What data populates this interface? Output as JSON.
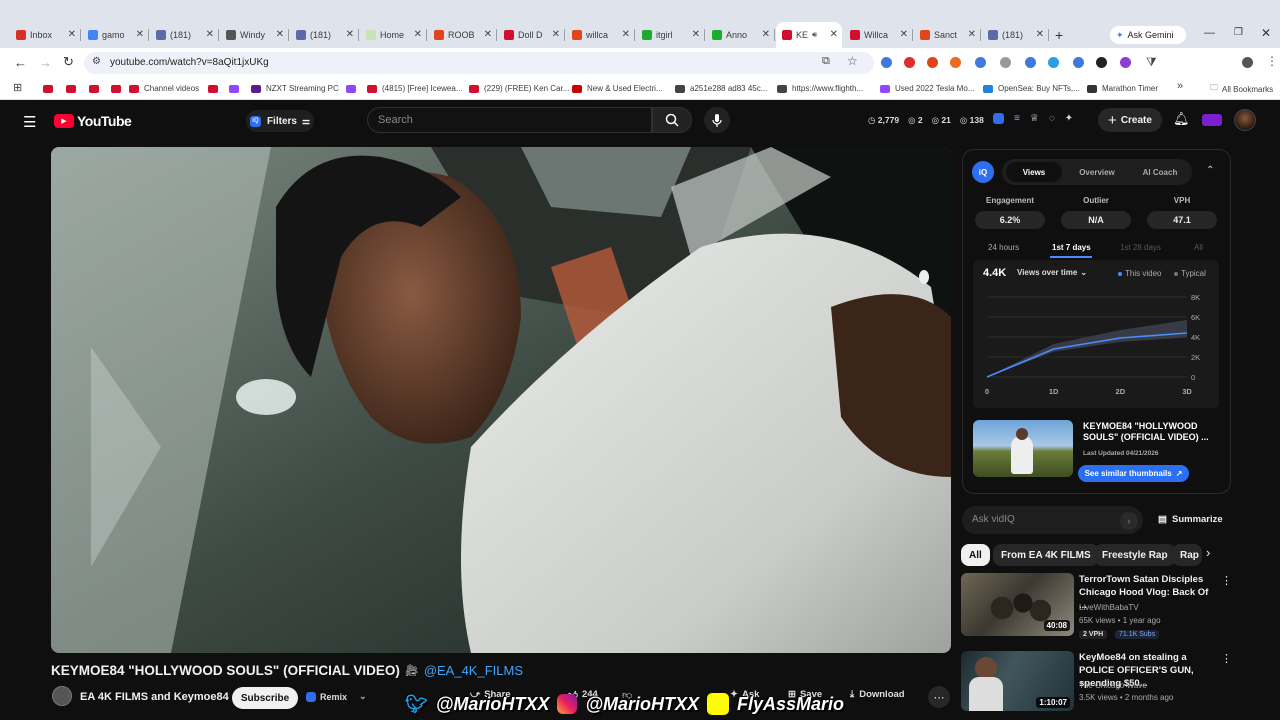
{
  "browser": {
    "tabs": [
      {
        "label": "Inbox",
        "color": "#d93025"
      },
      {
        "label": "gamo",
        "color": "#4285f4"
      },
      {
        "label": "(181)",
        "color": "#5b6ba8"
      },
      {
        "label": "Windy",
        "color": "#555"
      },
      {
        "label": "(181)",
        "color": "#5b6ba8"
      },
      {
        "label": "Home",
        "color": "#c9e2b3"
      },
      {
        "label": "ROOB",
        "color": "#e0451b"
      },
      {
        "label": "Doll D",
        "color": "#d20f2e"
      },
      {
        "label": "willca",
        "color": "#e0451b"
      },
      {
        "label": "itgirl",
        "color": "#1dab2f"
      },
      {
        "label": "Anno",
        "color": "#1dab2f"
      },
      {
        "label": "KE",
        "color": "#d20f2e"
      },
      {
        "label": "Willca",
        "color": "#d20f2e"
      },
      {
        "label": "Sanct",
        "color": "#e0451b"
      },
      {
        "label": "(181)",
        "color": "#5b6ba8"
      }
    ],
    "ask_gemini": "Ask Gemini",
    "url": "youtube.com/watch?v=8aQit1jxUKg",
    "bookmarks": [
      {
        "label": "",
        "color": "#d20f2e"
      },
      {
        "label": "",
        "color": "#d20f2e"
      },
      {
        "label": "",
        "color": "#d20f2e"
      },
      {
        "label": "",
        "color": "#d20f2e"
      },
      {
        "label": "Channel videos",
        "color": "#d20f2e"
      },
      {
        "label": "",
        "color": "#d20f2e"
      },
      {
        "label": "",
        "color": "#9146ff"
      },
      {
        "label": "NZXT Streaming PC",
        "color": "#5b1d8c"
      },
      {
        "label": "",
        "color": "#9146ff"
      },
      {
        "label": "(4815) [Free] Icewea...",
        "color": "#d20f2e"
      },
      {
        "label": "(229) (FREE) Ken Car...",
        "color": "#d20f2e"
      },
      {
        "label": "New & Used Electri...",
        "color": "#cc0000"
      },
      {
        "label": "a251e288 ad83 45c...",
        "color": "#444"
      },
      {
        "label": "https://www.flighth...",
        "color": "#444"
      },
      {
        "label": "Used 2022 Tesla Mo...",
        "color": "#9146ff"
      },
      {
        "label": "OpenSea: Buy NFTs,...",
        "color": "#2081e2"
      },
      {
        "label": "Marathon Timer",
        "color": "#333"
      }
    ],
    "all_bookmarks": "All Bookmarks"
  },
  "youtube": {
    "logo": "YouTube",
    "filters": "Filters",
    "search_placeholder": "Search",
    "stats": {
      "a": "2,779",
      "b": "2",
      "c": "21",
      "d": "138"
    },
    "create": "Create",
    "video": {
      "title": "KEYMOE84 \"HOLLYWOOD SOULS\" (OFFICIAL VIDEO)",
      "handle": "@EA_4K_FILMS",
      "channel": "EA 4K FILMS and Keymoe84",
      "subscribe": "Subscribe",
      "remix": "Remix",
      "share": "Share",
      "likes": "244",
      "ask": "Ask",
      "save": "Save",
      "download": "Download"
    },
    "overlay": {
      "twitter": "@MarioHTXX",
      "instagram": "@MarioHTXX",
      "snapchat": "FlyAssMario"
    }
  },
  "vidiq": {
    "tabs": [
      "Views",
      "Overview",
      "AI Coach"
    ],
    "metrics": [
      {
        "label": "Engagement",
        "value": "6.2%"
      },
      {
        "label": "Outlier",
        "value": "N/A"
      },
      {
        "label": "VPH",
        "value": "47.1"
      }
    ],
    "ranges": [
      "24 hours",
      "1st 7 days",
      "1st 28 days",
      "All"
    ],
    "views_total": "4.4K",
    "views_over_time": "Views over time",
    "legend_this": "This video",
    "legend_typical": "Typical",
    "thumb_title": "KEYMOE84 \"HOLLYWOOD SOULS\" (OFFICIAL VIDEO) ...",
    "last_updated": "Last Updated 04/21/2026",
    "see_similar": "See similar thumbnails",
    "ask_placeholder": "Ask vidIQ",
    "summarize": "Summarize"
  },
  "chart_data": {
    "type": "area",
    "x": [
      "0",
      "1D",
      "2D",
      "3D"
    ],
    "series": [
      {
        "name": "This video",
        "values": [
          0,
          2800,
          3900,
          4400
        ]
      },
      {
        "name": "Typical",
        "values": [
          0,
          3300,
          4700,
          5700
        ]
      }
    ],
    "yticks": [
      "8K",
      "6K",
      "4K",
      "2K",
      "0"
    ],
    "ylim": [
      0,
      8000
    ]
  },
  "chips": [
    "All",
    "From EA 4K FILMS",
    "Freestyle Rap",
    "Rap"
  ],
  "recommendations": [
    {
      "title": "TerrorTown Satan Disciples Chicago Hood Vlog: Back Of ...",
      "channel": "LiveWithBabaTV",
      "meta": "65K views • 1 year ago",
      "duration": "40:08",
      "vph": "2 VPH",
      "subs": "71.1K Subs"
    },
    {
      "title": "KeyMoe84 on stealing a POLICE OFFICER'S GUN, spending $50...",
      "channel": "The Chicago Wave",
      "meta": "3.5K views • 2 months ago",
      "duration": "1:10:07"
    }
  ]
}
